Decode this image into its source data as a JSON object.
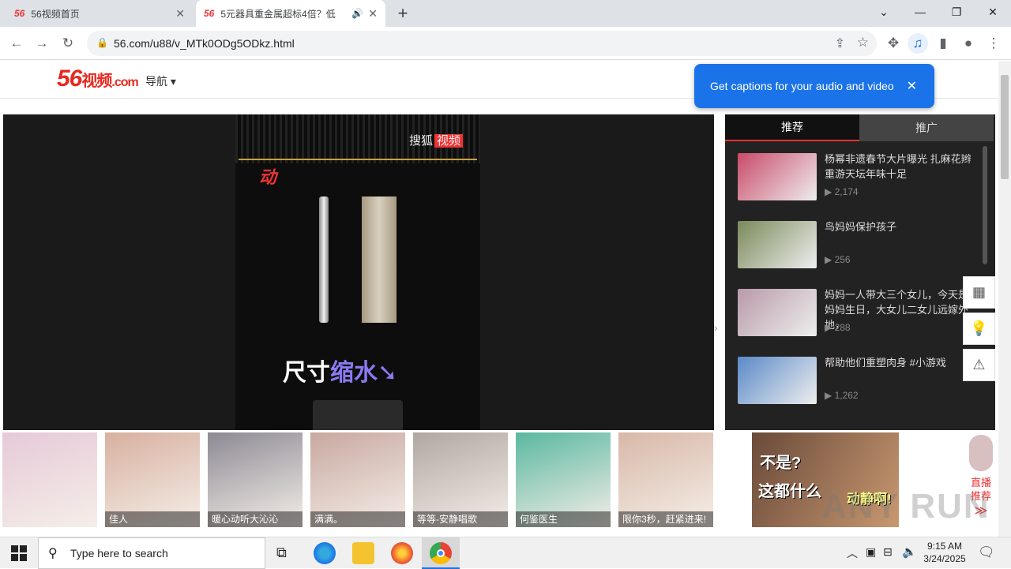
{
  "tabs": [
    {
      "favicon": "56",
      "title": "56视频首页",
      "close": "✕"
    },
    {
      "favicon": "56",
      "title": "5元器具重金属超标4倍？低",
      "close": "✕"
    }
  ],
  "new_tab": "+",
  "window_controls": {
    "dropdown": "⌄",
    "minimize": "—",
    "restore": "❐",
    "close": "✕"
  },
  "toolbar": {
    "back": "←",
    "forward": "→",
    "reload": "↻",
    "url": "56.com/u88/v_MTk0ODg5ODkz.html"
  },
  "popup": {
    "text": "Get captions for your audio and video",
    "close": "✕"
  },
  "site": {
    "logo_num": "56",
    "logo_text": "视频",
    "logo_com": ".com",
    "nav_label": "导航 ▾"
  },
  "video": {
    "watermark_a": "搜狐",
    "watermark_b": "视频",
    "brand": "动",
    "caption_a": "尺寸",
    "caption_b": "缩水",
    "tick_labels": [
      "",
      "",
      "",
      ""
    ]
  },
  "side_tabs": [
    "推荐",
    "推广"
  ],
  "recommendations": [
    {
      "title": "杨幂非遗春节大片曝光 扎麻花辫重游天坛年味十足",
      "views": "2,174",
      "color": "#c94a6a"
    },
    {
      "title": "鸟妈妈保护孩子",
      "views": "256",
      "color": "#7a8a5a"
    },
    {
      "title": "妈妈一人带大三个女儿，今天是妈妈生日，大女儿二女儿远嫁外地，",
      "views": "288",
      "color": "#b89aa8"
    },
    {
      "title": "帮助他们重塑肉身 #小游戏",
      "views": "1,262",
      "color": "#5a8ac8"
    }
  ],
  "bottom_items": [
    {
      "caption": "",
      "color": "#e6c9d8"
    },
    {
      "caption": "佳人",
      "color": "#d8b0a0"
    },
    {
      "caption": "暖心动听大沁沁",
      "color": "#8c8a94"
    },
    {
      "caption": "满满。",
      "color": "#c8a8a0"
    },
    {
      "caption": "等等-安静唱歌",
      "color": "#b0a8a0"
    },
    {
      "caption": "何鉴医生",
      "color": "#5ab8a0"
    },
    {
      "caption": "限你3秒，赶紧进来!",
      "color": "#d8b8a8"
    }
  ],
  "ad": {
    "text_a": "不是?",
    "text_b": "这都什么",
    "text_c": "动静啊!",
    "color": "#6a4a3a"
  },
  "live_widget": {
    "label": "直播推荐",
    "arrow": "≫"
  },
  "taskbar": {
    "search_placeholder": "Type here to search",
    "time": "9:15 AM",
    "date": "3/24/2025"
  },
  "watermark": "ANY RUN"
}
